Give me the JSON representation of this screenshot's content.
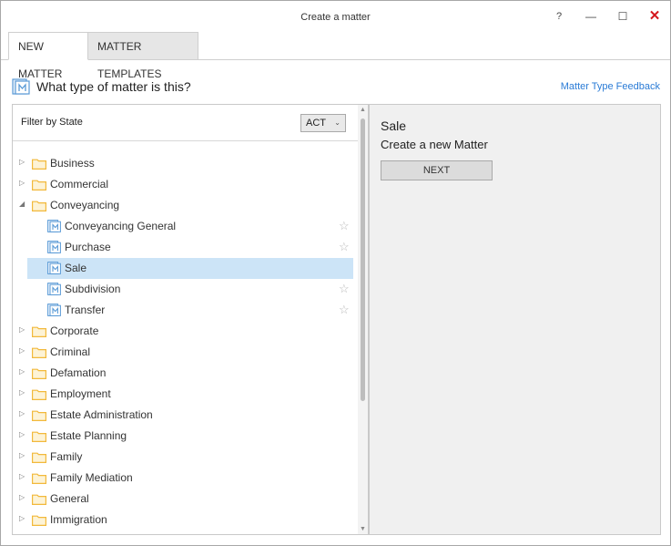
{
  "window": {
    "title": "Create a matter",
    "help": "?",
    "minimize": "—",
    "maximize": "☐",
    "close": "✕"
  },
  "tabs": [
    {
      "label": "NEW MATTER",
      "active": true
    },
    {
      "label": "MATTER TEMPLATES",
      "active": false
    }
  ],
  "header": {
    "title": "What type of matter is this?",
    "feedback_link": "Matter Type Feedback"
  },
  "filter": {
    "label": "Filter by State",
    "selected_state": "ACT"
  },
  "tree": [
    {
      "label": "Business",
      "type": "category",
      "expanded": false
    },
    {
      "label": "Commercial",
      "type": "category",
      "expanded": false
    },
    {
      "label": "Conveyancing",
      "type": "category",
      "expanded": true
    },
    {
      "label": "Conveyancing General",
      "type": "matter",
      "selected": false
    },
    {
      "label": "Purchase",
      "type": "matter",
      "selected": false
    },
    {
      "label": "Sale",
      "type": "matter",
      "selected": true
    },
    {
      "label": "Subdivision",
      "type": "matter",
      "selected": false
    },
    {
      "label": "Transfer",
      "type": "matter",
      "selected": false
    },
    {
      "label": "Corporate",
      "type": "category",
      "expanded": false
    },
    {
      "label": "Criminal",
      "type": "category",
      "expanded": false
    },
    {
      "label": "Defamation",
      "type": "category",
      "expanded": false
    },
    {
      "label": "Employment",
      "type": "category",
      "expanded": false
    },
    {
      "label": "Estate Administration",
      "type": "category",
      "expanded": false
    },
    {
      "label": "Estate Planning",
      "type": "category",
      "expanded": false
    },
    {
      "label": "Family",
      "type": "category",
      "expanded": false
    },
    {
      "label": "Family Mediation",
      "type": "category",
      "expanded": false
    },
    {
      "label": "General",
      "type": "category",
      "expanded": false
    },
    {
      "label": "Immigration",
      "type": "category",
      "expanded": false
    }
  ],
  "detail": {
    "title": "Sale",
    "subtitle": "Create a new Matter",
    "next_label": "NEXT"
  },
  "colors": {
    "accent": "#2a7bd6",
    "selection": "#cce4f7",
    "folder": "#f2b93b",
    "close": "#d4161c"
  },
  "icons": {
    "matter_type": "matter-type-icon",
    "folder": "folder-icon",
    "favorite": "star-icon"
  }
}
